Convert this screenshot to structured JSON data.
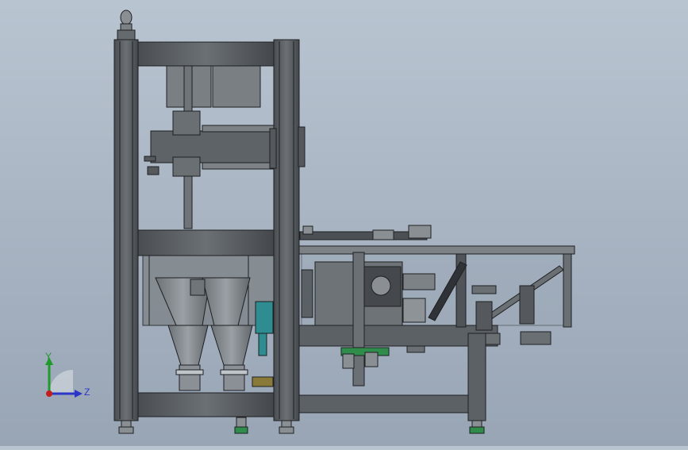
{
  "viewport": {
    "background_top": "#b9c4d1",
    "background_bottom": "#98a5b5",
    "model_color": "#5b5f63",
    "model_edge_color": "#1e2022"
  },
  "triad": {
    "x_label": "",
    "y_label": "Y",
    "z_label": "Z",
    "colors": {
      "y": "#1f9a2b",
      "z": "#2b36c7",
      "origin": "#c41d1d"
    }
  }
}
